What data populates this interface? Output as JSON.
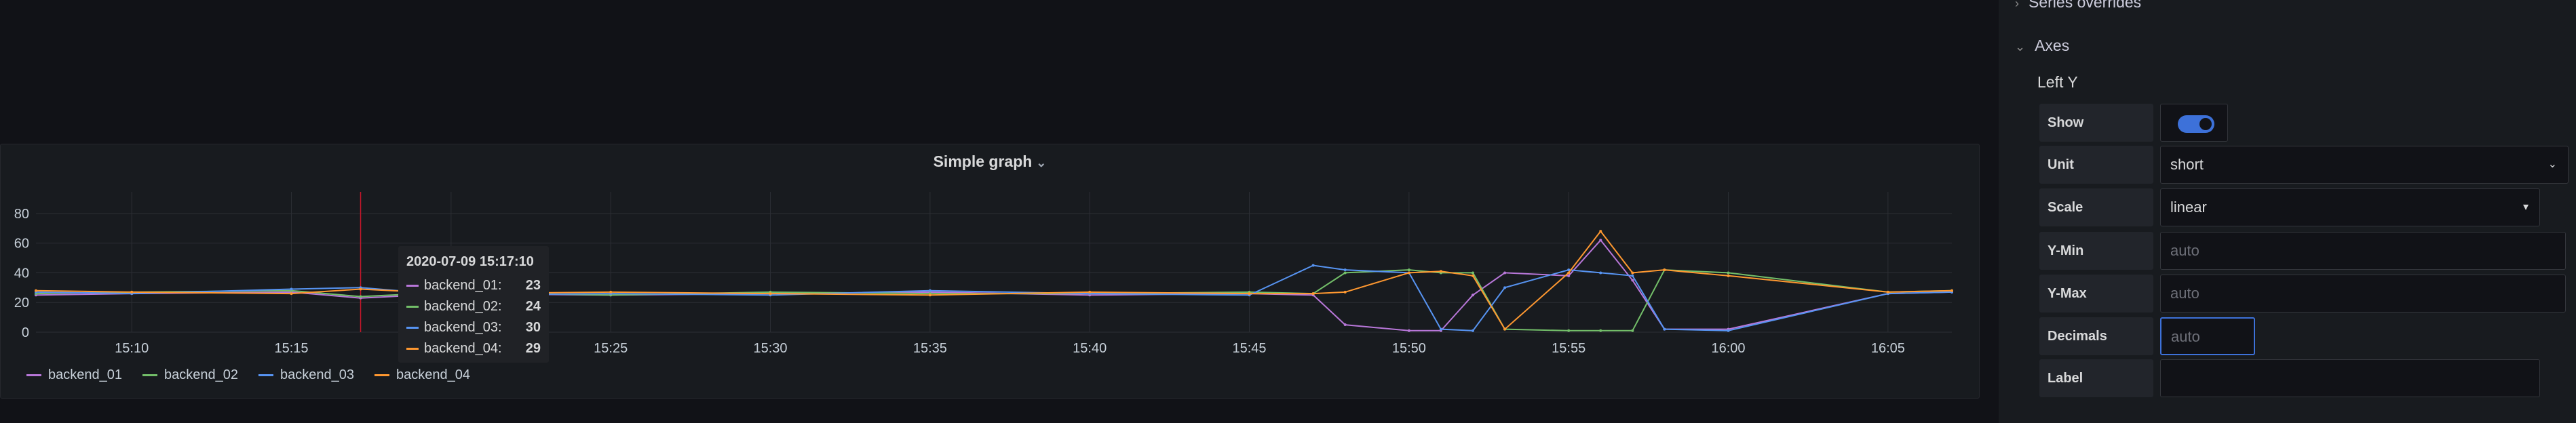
{
  "panel": {
    "title": "Simple graph"
  },
  "tooltip": {
    "time": "2020-07-09 15:17:10",
    "rows": [
      {
        "name": "backend_01:",
        "value": "23",
        "color": "#b877d9"
      },
      {
        "name": "backend_02:",
        "value": "24",
        "color": "#73bf69"
      },
      {
        "name": "backend_03:",
        "value": "30",
        "color": "#5794f2"
      },
      {
        "name": "backend_04:",
        "value": "29",
        "color": "#ff9830"
      }
    ]
  },
  "options": {
    "series_overrides": "Series overrides",
    "axes": "Axes",
    "left_y": "Left Y",
    "show_label": "Show",
    "show_enabled": true,
    "unit_label": "Unit",
    "unit_value": "short",
    "scale_label": "Scale",
    "scale_value": "linear",
    "ymin_label": "Y-Min",
    "ymin_placeholder": "auto",
    "ymax_label": "Y-Max",
    "ymax_placeholder": "auto",
    "decimals_label": "Decimals",
    "decimals_placeholder": "auto",
    "label_label": "Label",
    "label_value": ""
  },
  "chart_data": {
    "type": "line",
    "x": [
      "15:07",
      "15:10",
      "15:15",
      "15:17:10",
      "15:20",
      "15:25",
      "15:30",
      "15:35",
      "15:40",
      "15:45",
      "15:47",
      "15:48",
      "15:50",
      "15:51",
      "15:52",
      "15:53",
      "15:55",
      "15:56",
      "15:57",
      "15:58",
      "16:00",
      "16:05",
      "16:07"
    ],
    "x_ticks": [
      "15:10",
      "15:15",
      "15:20",
      "15:25",
      "15:30",
      "15:35",
      "15:40",
      "15:45",
      "15:50",
      "15:55",
      "16:00",
      "16:05"
    ],
    "y_ticks": [
      "0",
      "20",
      "40",
      "60",
      "80"
    ],
    "ylim": [
      0,
      90
    ],
    "cursor_x": "15:17:10",
    "series": [
      {
        "name": "backend_01",
        "color": "#b877d9",
        "values": [
          25,
          26,
          27,
          23,
          26,
          25,
          26,
          27,
          25,
          26,
          25,
          5,
          1,
          1,
          25,
          40,
          38,
          62,
          35,
          2,
          2,
          26,
          27
        ]
      },
      {
        "name": "backend_02",
        "color": "#73bf69",
        "values": [
          26,
          27,
          28,
          24,
          27,
          25,
          27,
          26,
          26,
          27,
          26,
          40,
          42,
          40,
          40,
          2,
          1,
          1,
          1,
          42,
          40,
          27,
          28
        ]
      },
      {
        "name": "backend_03",
        "color": "#5794f2",
        "values": [
          27,
          26,
          29,
          30,
          25,
          26,
          25,
          28,
          26,
          25,
          45,
          42,
          40,
          2,
          1,
          30,
          42,
          40,
          38,
          2,
          1,
          26,
          27
        ]
      },
      {
        "name": "backend_04",
        "color": "#ff9830",
        "values": [
          28,
          27,
          26,
          29,
          26,
          27,
          26,
          25,
          27,
          26,
          26,
          27,
          40,
          41,
          38,
          2,
          40,
          68,
          40,
          42,
          38,
          27,
          28
        ]
      }
    ]
  }
}
